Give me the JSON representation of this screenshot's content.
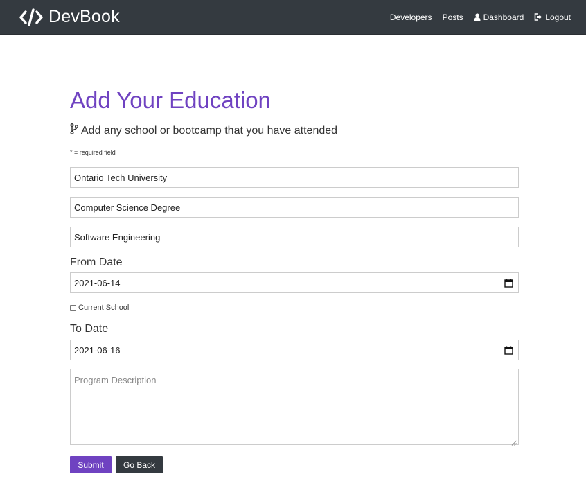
{
  "navbar": {
    "brand": "DevBook",
    "links": [
      {
        "label": "Developers"
      },
      {
        "label": "Posts"
      },
      {
        "label": "Dashboard",
        "icon": "user-icon"
      },
      {
        "label": "Logout",
        "icon": "sign-out-icon"
      }
    ]
  },
  "form": {
    "title": "Add Your Education",
    "lead": "Add any school or bootcamp that you have attended",
    "required_note": "* = required field",
    "school_value": "Ontario Tech University",
    "degree_value": "Computer Science Degree",
    "field_of_study_value": "Software Engineering",
    "from_label": "From Date",
    "from_value": "2021-06-14",
    "current_label": "Current School",
    "current_checked": false,
    "to_label": "To Date",
    "to_value": "2021-06-16",
    "description_placeholder": "Program Description",
    "submit_label": "Submit",
    "back_label": "Go Back"
  },
  "colors": {
    "accent": "#6f42c1",
    "navbar": "#343a40"
  }
}
